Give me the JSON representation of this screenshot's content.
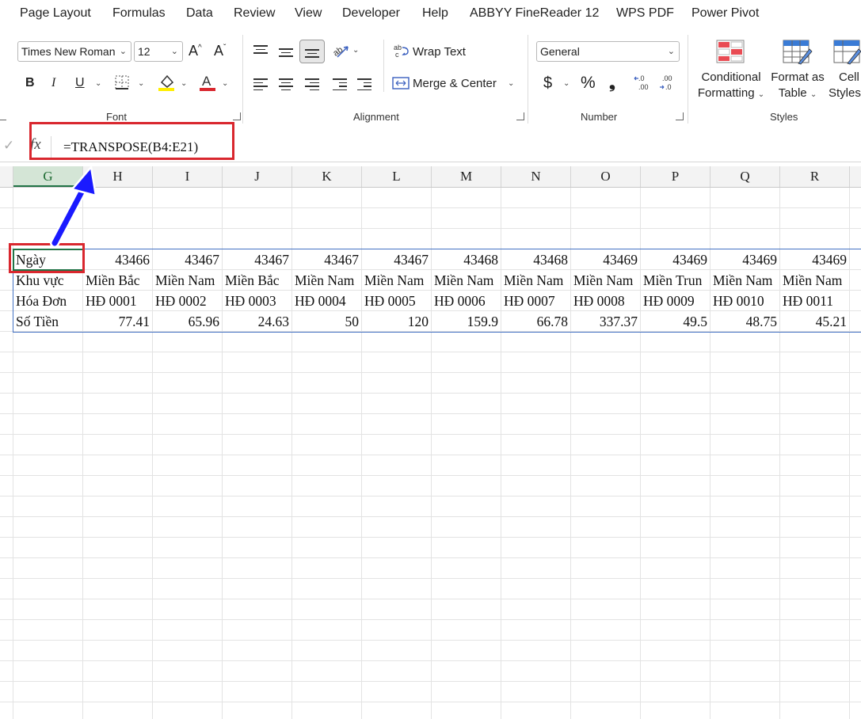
{
  "menu": [
    "Page Layout",
    "Formulas",
    "Data",
    "Review",
    "View",
    "Developer",
    "Help",
    "ABBYY FineReader 12",
    "WPS PDF",
    "Power Pivot"
  ],
  "ribbon": {
    "font": {
      "name": "Times New Roman",
      "size": "12",
      "grow": "A^",
      "shrink": "Aˇ",
      "bold": "B",
      "italic": "I",
      "underline": "U",
      "group_label": "Font"
    },
    "alignment": {
      "wrap_text": "Wrap Text",
      "merge_center": "Merge & Center",
      "group_label": "Alignment"
    },
    "number": {
      "format": "General",
      "currency": "$",
      "percent": "%",
      "comma": "❟",
      "inc_decimal": "←.0 .00",
      "dec_decimal": ".00 →.0",
      "group_label": "Number"
    },
    "styles": {
      "conditional_line1": "Conditional",
      "conditional_line2": "Formatting",
      "format_table_line1": "Format as",
      "format_table_line2": "Table",
      "cell_styles_line1": "Cell",
      "cell_styles_line2": "Styles",
      "group_label": "Styles"
    }
  },
  "formula_bar": {
    "check": "✓",
    "fx": "fx",
    "formula": "=TRANSPOSE(B4:E21)"
  },
  "columns": [
    "G",
    "H",
    "I",
    "J",
    "K",
    "L",
    "M",
    "N",
    "O",
    "P",
    "Q",
    "R"
  ],
  "selected_column": "G",
  "rows": [
    {
      "label": "Ngày",
      "values": [
        "43466",
        "43467",
        "43467",
        "43467",
        "43467",
        "43468",
        "43468",
        "43469",
        "43469",
        "43469",
        "43469"
      ]
    },
    {
      "label": "Khu vực",
      "values": [
        "Miền Bắc",
        "Miền Nam",
        "Miền Bắc",
        "Miền Nam",
        "Miền Nam",
        "Miền Nam",
        "Miền Nam",
        "Miền Nam",
        "Miền Trun",
        "Miền Nam",
        "Miền Nam"
      ]
    },
    {
      "label": "Hóa Đơn",
      "values": [
        "HĐ 0001",
        "HĐ 0002",
        "HĐ 0003",
        "HĐ 0004",
        "HĐ 0005",
        "HĐ 0006",
        "HĐ 0007",
        "HĐ 0008",
        "HĐ 0009",
        "HĐ 0010",
        "HĐ 0011"
      ]
    },
    {
      "label": "Số Tiền",
      "values": [
        "77.41",
        "65.96",
        "24.63",
        "50",
        "120",
        "159.9",
        "66.78",
        "337.37",
        "49.5",
        "48.75",
        "45.21"
      ]
    }
  ],
  "colors": {
    "highlight_red": "#d9272e",
    "arrow_blue": "#1a1aff",
    "excel_green": "#217346"
  }
}
